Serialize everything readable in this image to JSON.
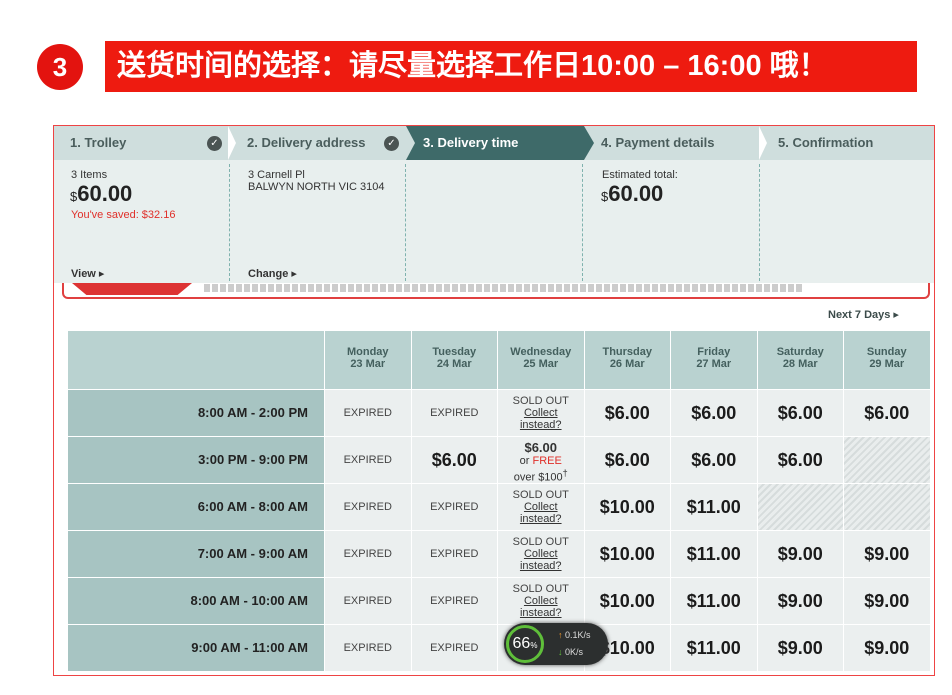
{
  "banner": {
    "step_number": "3",
    "title": "送货时间的选择：请尽量选择工作日10:00 – 16:00 哦！"
  },
  "steps": [
    {
      "label": "1. Trolley",
      "done": true
    },
    {
      "label": "2. Delivery address",
      "done": true
    },
    {
      "label": "3. Delivery time",
      "active": true
    },
    {
      "label": "4. Payment details"
    },
    {
      "label": "5. Confirmation"
    }
  ],
  "trolley": {
    "items": "3 Items",
    "currency": "$",
    "amount": "60.00",
    "saved": "You've saved: $32.16",
    "view": "View"
  },
  "address": {
    "line1": "3 Carnell Pl",
    "line2": "BALWYN NORTH VIC 3104",
    "change": "Change"
  },
  "payment": {
    "label": "Estimated total:",
    "currency": "$",
    "amount": "60.00"
  },
  "next_days": "Next 7 Days",
  "days": [
    {
      "day": "Monday",
      "date": "23 Mar"
    },
    {
      "day": "Tuesday",
      "date": "24 Mar"
    },
    {
      "day": "Wednesday",
      "date": "25 Mar"
    },
    {
      "day": "Thursday",
      "date": "26 Mar"
    },
    {
      "day": "Friday",
      "date": "27 Mar"
    },
    {
      "day": "Saturday",
      "date": "28 Mar"
    },
    {
      "day": "Sunday",
      "date": "29 Mar"
    }
  ],
  "slots": [
    {
      "time": "8:00 AM - 2:00 PM",
      "cells": [
        "EXPIRED",
        "EXPIRED",
        "SOLD_OUT",
        "$6.00",
        "$6.00",
        "$6.00",
        "$6.00"
      ]
    },
    {
      "time": "3:00 PM - 9:00 PM",
      "cells": [
        "EXPIRED",
        "$6.00",
        "FREE_OFFER",
        "$6.00",
        "$6.00",
        "$6.00",
        "NA"
      ]
    },
    {
      "time": "6:00 AM - 8:00 AM",
      "cells": [
        "EXPIRED",
        "EXPIRED",
        "SOLD_OUT",
        "$10.00",
        "$11.00",
        "NA",
        "NA"
      ]
    },
    {
      "time": "7:00 AM - 9:00 AM",
      "cells": [
        "EXPIRED",
        "EXPIRED",
        "SOLD_OUT",
        "$10.00",
        "$11.00",
        "$9.00",
        "$9.00"
      ]
    },
    {
      "time": "8:00 AM - 10:00 AM",
      "cells": [
        "EXPIRED",
        "EXPIRED",
        "SOLD_OUT",
        "$10.00",
        "$11.00",
        "$9.00",
        "$9.00"
      ]
    },
    {
      "time": "9:00 AM - 11:00 AM",
      "cells": [
        "EXPIRED",
        "EXPIRED",
        "",
        "$10.00",
        "$11.00",
        "$9.00",
        "$9.00"
      ]
    }
  ],
  "sold_out": {
    "label": "SOLD OUT",
    "link1": "Collect",
    "link2": "instead?"
  },
  "free_offer": {
    "price": "$6.00",
    "or": "or",
    "free": "FREE",
    "over": "over $100",
    "mark": "†"
  },
  "widget": {
    "percent": "66",
    "unit": "%",
    "up": "0.1K/s",
    "down": "0K/s"
  }
}
